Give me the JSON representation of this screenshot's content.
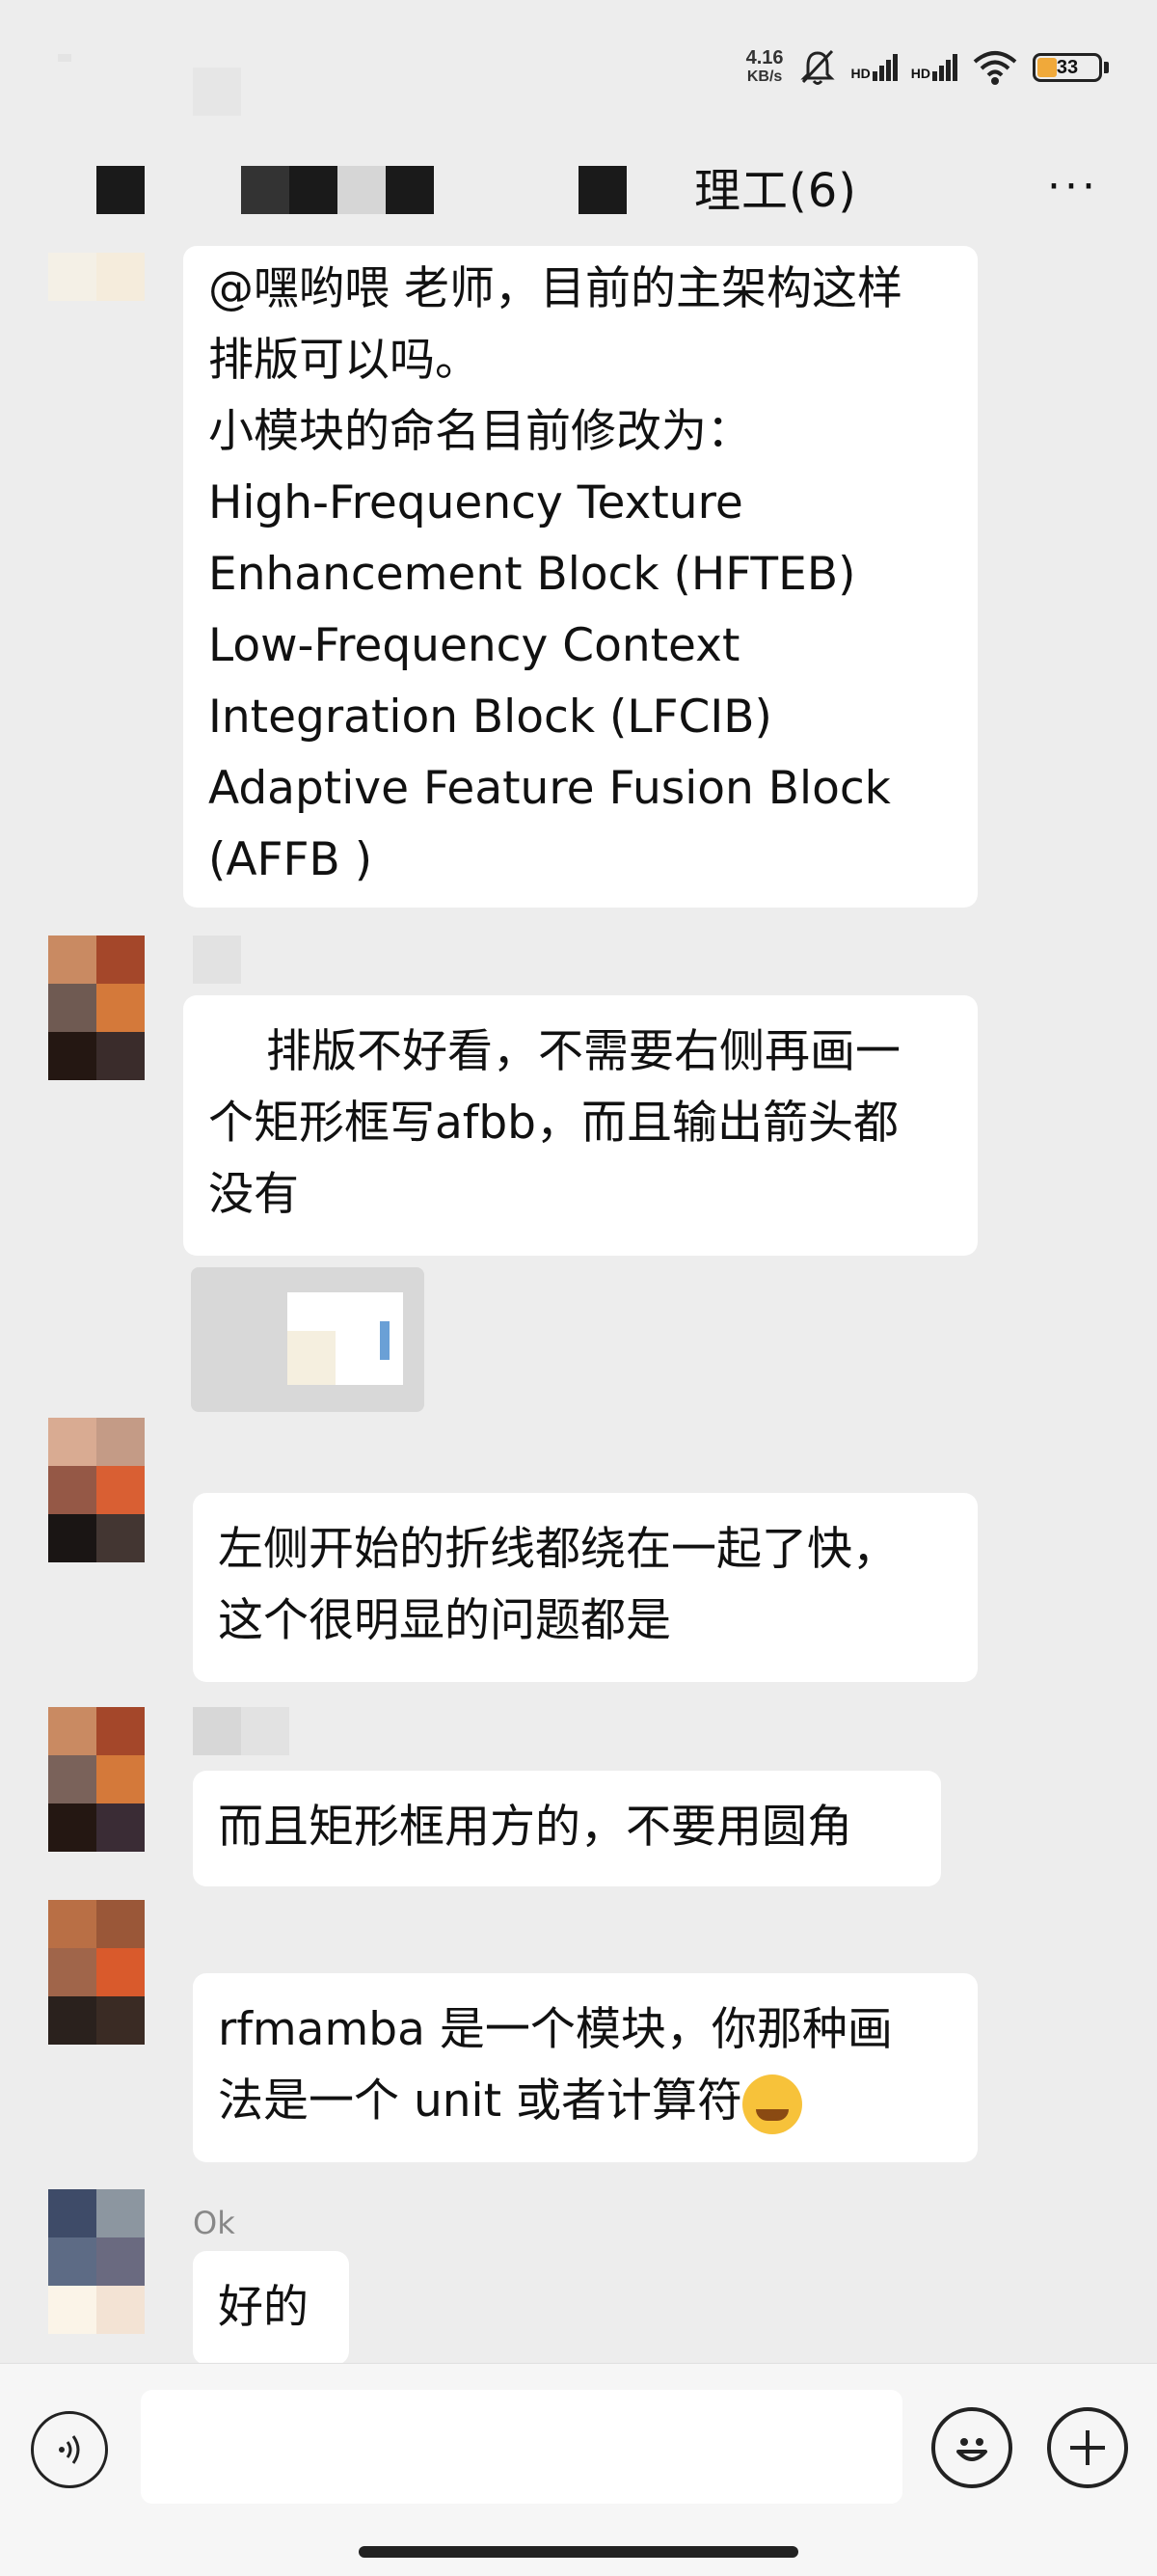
{
  "status_bar": {
    "speed_value": "4.16",
    "speed_unit": "KB/s",
    "signal1": "HD",
    "signal2": "HD",
    "battery": "33",
    "battery_level_pct": 33
  },
  "header": {
    "title": "理工(6)",
    "more": "···"
  },
  "messages": [
    {
      "lines": [
        "@嘿哟喂 老师，目前的主架构这样",
        "排版可以吗。",
        "小模块的命名目前修改为：",
        "High-Frequency Texture",
        "Enhancement Block (HFTEB)",
        "Low-Frequency Context",
        "Integration Block (LFCIB)",
        "Adaptive Feature Fusion Block",
        "(AFFB )"
      ]
    },
    {
      "lines": [
        "排版不好看，不需要右侧再画一",
        "个矩形框写afbb，而且输出箭头都",
        "没有"
      ]
    },
    {
      "lines": [
        "左侧开始的折线都绕在一起了快，",
        "这个很明显的问题都是"
      ]
    },
    {
      "lines": [
        "而且矩形框用方的，不要用圆角"
      ]
    },
    {
      "lines": [
        "rfmamba 是一个模块，你那种画",
        "法是一个 unit 或者计算符"
      ]
    },
    {
      "nick": "Ok",
      "lines": [
        "好的"
      ]
    }
  ],
  "avatars": {
    "colors_a": [
      "#c98a62",
      "#a4472a",
      "#6f5a52",
      "#d4793a",
      "#241712",
      "#3a2c2b"
    ],
    "colors_b": [
      "#d9ab92",
      "#c49b86",
      "#955846",
      "#d95f33",
      "#1a1514",
      "#433632"
    ],
    "colors_c": [
      "#c98a62",
      "#a4472a",
      "#7a625a",
      "#d4793a",
      "#241712",
      "#3a2c35"
    ],
    "colors_d": [
      "#b96f45",
      "#9a5738",
      "#a0654a",
      "#d95a2c",
      "#2a211d",
      "#3a2b24"
    ],
    "colors_e": [
      "#3e4b68",
      "#8c96a0",
      "#5d6b85",
      "#6a6a80",
      "#fbf4e8",
      "#f3e3d4"
    ],
    "colors_top": [
      "#f4f0e6",
      "#f5ecdc"
    ]
  },
  "input": {
    "placeholder": ""
  }
}
